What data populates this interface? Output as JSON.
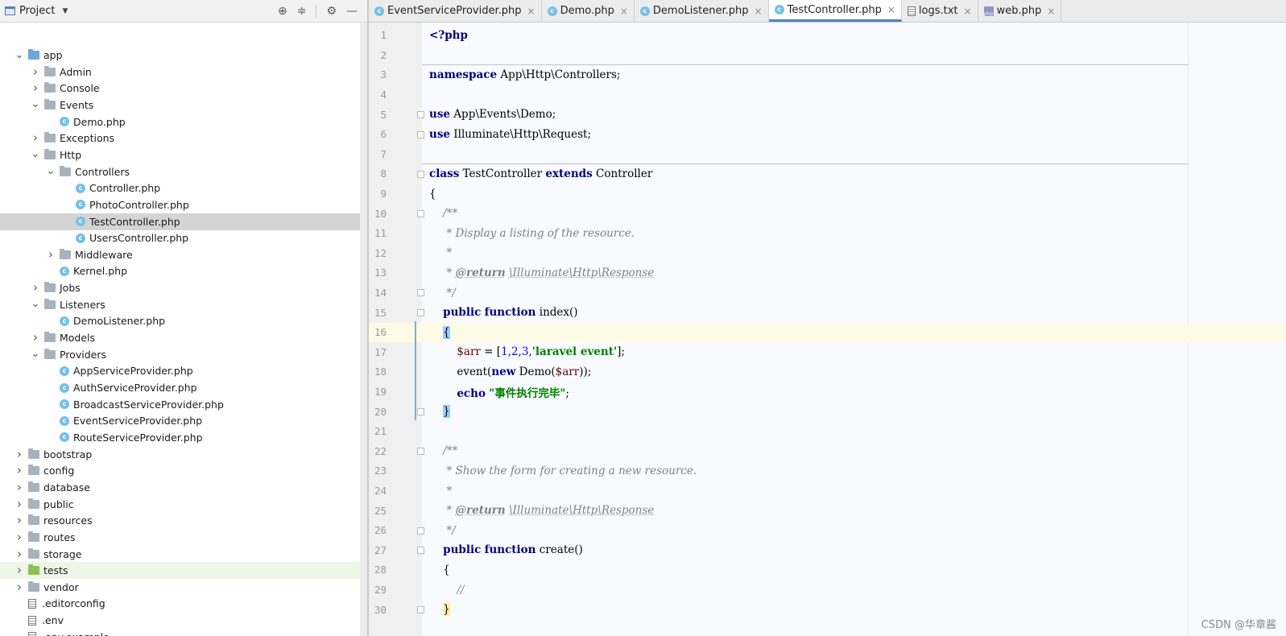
{
  "project": {
    "title": "Project",
    "icons": [
      "locate-icon",
      "collapse-icon",
      "gear-icon",
      "minimize-icon"
    ],
    "tree": [
      {
        "label": "app",
        "type": "folder-blue",
        "depth": 1,
        "expanded": true
      },
      {
        "label": "Admin",
        "type": "folder",
        "depth": 2,
        "expanded": false
      },
      {
        "label": "Console",
        "type": "folder",
        "depth": 2,
        "expanded": false
      },
      {
        "label": "Events",
        "type": "folder",
        "depth": 2,
        "expanded": true
      },
      {
        "label": "Demo.php",
        "type": "php",
        "depth": 3
      },
      {
        "label": "Exceptions",
        "type": "folder",
        "depth": 2,
        "expanded": false
      },
      {
        "label": "Http",
        "type": "folder",
        "depth": 2,
        "expanded": true
      },
      {
        "label": "Controllers",
        "type": "folder",
        "depth": 3,
        "expanded": true
      },
      {
        "label": "Controller.php",
        "type": "php",
        "depth": 4
      },
      {
        "label": "PhotoController.php",
        "type": "php",
        "depth": 4
      },
      {
        "label": "TestController.php",
        "type": "php",
        "depth": 4,
        "selected": true
      },
      {
        "label": "UsersController.php",
        "type": "php",
        "depth": 4
      },
      {
        "label": "Middleware",
        "type": "folder",
        "depth": 3,
        "expanded": false
      },
      {
        "label": "Kernel.php",
        "type": "php",
        "depth": 3
      },
      {
        "label": "Jobs",
        "type": "folder",
        "depth": 2,
        "expanded": false
      },
      {
        "label": "Listeners",
        "type": "folder",
        "depth": 2,
        "expanded": true
      },
      {
        "label": "DemoListener.php",
        "type": "php",
        "depth": 3
      },
      {
        "label": "Models",
        "type": "folder",
        "depth": 2,
        "expanded": false
      },
      {
        "label": "Providers",
        "type": "folder",
        "depth": 2,
        "expanded": true
      },
      {
        "label": "AppServiceProvider.php",
        "type": "php",
        "depth": 3
      },
      {
        "label": "AuthServiceProvider.php",
        "type": "php",
        "depth": 3
      },
      {
        "label": "BroadcastServiceProvider.php",
        "type": "php",
        "depth": 3
      },
      {
        "label": "EventServiceProvider.php",
        "type": "php",
        "depth": 3
      },
      {
        "label": "RouteServiceProvider.php",
        "type": "php",
        "depth": 3
      },
      {
        "label": "bootstrap",
        "type": "folder",
        "depth": 1,
        "expanded": false
      },
      {
        "label": "config",
        "type": "folder",
        "depth": 1,
        "expanded": false
      },
      {
        "label": "database",
        "type": "folder",
        "depth": 1,
        "expanded": false
      },
      {
        "label": "public",
        "type": "folder",
        "depth": 1,
        "expanded": false
      },
      {
        "label": "resources",
        "type": "folder",
        "depth": 1,
        "expanded": false
      },
      {
        "label": "routes",
        "type": "folder",
        "depth": 1,
        "expanded": false
      },
      {
        "label": "storage",
        "type": "folder",
        "depth": 1,
        "expanded": false
      },
      {
        "label": "tests",
        "type": "folder-green",
        "depth": 1,
        "expanded": false,
        "highlight": true
      },
      {
        "label": "vendor",
        "type": "folder",
        "depth": 1,
        "expanded": false
      },
      {
        "label": ".editorconfig",
        "type": "file",
        "depth": 1
      },
      {
        "label": ".env",
        "type": "file",
        "depth": 1
      },
      {
        "label": ".env.example",
        "type": "file",
        "depth": 1
      }
    ]
  },
  "tabs": [
    {
      "label": "EventServiceProvider.php",
      "icon": "php-class-icon",
      "active": false
    },
    {
      "label": "Demo.php",
      "icon": "php-class-icon",
      "active": false
    },
    {
      "label": "DemoListener.php",
      "icon": "php-class-icon",
      "active": false
    },
    {
      "label": "TestController.php",
      "icon": "php-class-icon",
      "active": true
    },
    {
      "label": "logs.txt",
      "icon": "text-file-icon",
      "active": false
    },
    {
      "label": "web.php",
      "icon": "php-file-icon",
      "active": false
    }
  ],
  "editor": {
    "current_line": 16,
    "lines": [
      [
        {
          "t": "<?php",
          "c": "kw"
        }
      ],
      [],
      [
        {
          "t": "namespace",
          "c": "kw"
        },
        {
          "t": " App\\Http\\Controllers;"
        }
      ],
      [],
      [
        {
          "t": "use",
          "c": "kw"
        },
        {
          "t": " App\\Events\\Demo;"
        }
      ],
      [
        {
          "t": "use",
          "c": "kw"
        },
        {
          "t": " Illuminate\\Http\\Request;"
        }
      ],
      [],
      [
        {
          "t": "class",
          "c": "kw"
        },
        {
          "t": " TestController "
        },
        {
          "t": "extends",
          "c": "kw"
        },
        {
          "t": " Controller"
        }
      ],
      [
        {
          "t": "{"
        }
      ],
      [
        {
          "t": "    "
        },
        {
          "t": "/**",
          "c": "cm"
        }
      ],
      [
        {
          "t": "     * Display a listing of the resource.",
          "c": "cm"
        }
      ],
      [
        {
          "t": "     *",
          "c": "cm"
        }
      ],
      [
        {
          "t": "     * ",
          "c": "cm"
        },
        {
          "t": "@return",
          "c": "tagcm"
        },
        {
          "t": " ",
          "c": "cm"
        },
        {
          "t": "\\Illuminate\\Http\\Response",
          "c": "ulcm"
        }
      ],
      [
        {
          "t": "     */",
          "c": "cm"
        }
      ],
      [
        {
          "t": "    "
        },
        {
          "t": "public",
          "c": "kw"
        },
        {
          "t": " "
        },
        {
          "t": "function",
          "c": "kw"
        },
        {
          "t": " index()"
        }
      ],
      [
        {
          "t": "    "
        },
        {
          "t": "{",
          "c": "brh"
        }
      ],
      [
        {
          "t": "        "
        },
        {
          "t": "$arr",
          "c": "var"
        },
        {
          "t": " = ["
        },
        {
          "t": "1",
          "c": "num"
        },
        {
          "t": ","
        },
        {
          "t": "2",
          "c": "num"
        },
        {
          "t": ","
        },
        {
          "t": "3",
          "c": "num"
        },
        {
          "t": ","
        },
        {
          "t": "'laravel event'",
          "c": "str"
        },
        {
          "t": "];"
        }
      ],
      [
        {
          "t": "        event("
        },
        {
          "t": "new",
          "c": "kw"
        },
        {
          "t": " Demo("
        },
        {
          "t": "$arr",
          "c": "var"
        },
        {
          "t": "));"
        }
      ],
      [
        {
          "t": "        "
        },
        {
          "t": "echo",
          "c": "kw"
        },
        {
          "t": " "
        },
        {
          "t": "\"事件执行完毕\"",
          "c": "str"
        },
        {
          "t": ";"
        }
      ],
      [
        {
          "t": "    "
        },
        {
          "t": "}",
          "c": "brh"
        }
      ],
      [],
      [
        {
          "t": "    "
        },
        {
          "t": "/**",
          "c": "cm"
        }
      ],
      [
        {
          "t": "     * Show the form for creating a new resource.",
          "c": "cm"
        }
      ],
      [
        {
          "t": "     *",
          "c": "cm"
        }
      ],
      [
        {
          "t": "     * ",
          "c": "cm"
        },
        {
          "t": "@return",
          "c": "tagcm"
        },
        {
          "t": " ",
          "c": "cm"
        },
        {
          "t": "\\Illuminate\\Http\\Response",
          "c": "ulcm"
        }
      ],
      [
        {
          "t": "     */",
          "c": "cm"
        }
      ],
      [
        {
          "t": "    "
        },
        {
          "t": "public",
          "c": "kw"
        },
        {
          "t": " "
        },
        {
          "t": "function",
          "c": "kw"
        },
        {
          "t": " create()"
        }
      ],
      [
        {
          "t": "    {"
        }
      ],
      [
        {
          "t": "        "
        },
        {
          "t": "//",
          "c": "cm"
        }
      ],
      [
        {
          "t": "    "
        },
        {
          "t": "}",
          "c": "bry"
        }
      ]
    ]
  },
  "watermark": "CSDN @华章酱"
}
